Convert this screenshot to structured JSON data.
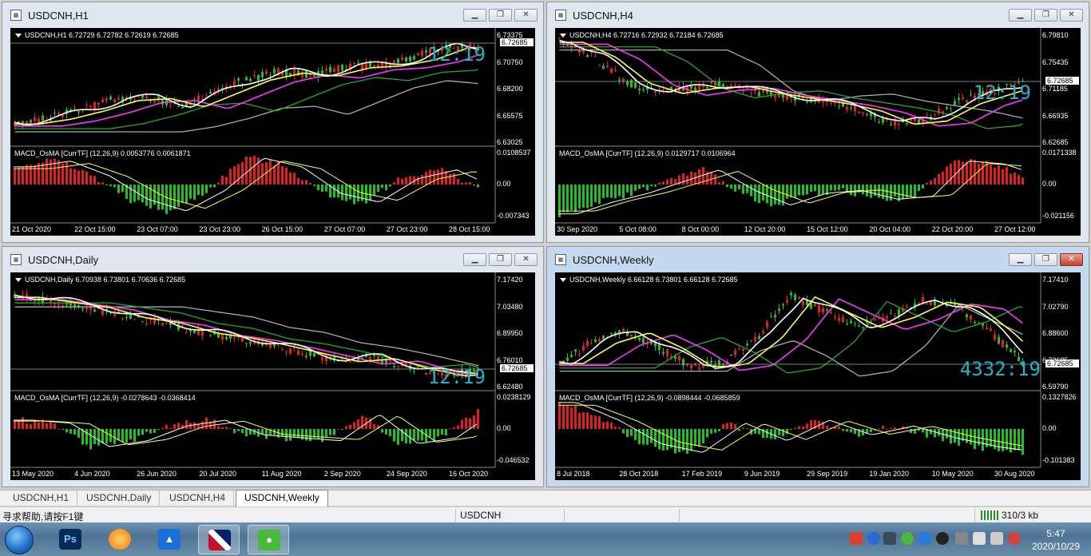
{
  "windows": [
    {
      "title": "USDCNH,H1",
      "header": "USDCNH,H1  6.72729 6.72782 6.72619 6.72685",
      "clock": "12:19",
      "y_main": [
        "6.73375",
        "6.70750",
        "6.68200",
        "6.65575",
        "6.63025"
      ],
      "price_tag": "6.72685",
      "macd_label": "MACD_OsMA [CurrTF] (12,26,9) 0.0053776 0.0061871",
      "y_macd": [
        "0.0108537",
        "0.00",
        "-0.007343"
      ],
      "x": [
        "21 Oct 2020",
        "22 Oct 15:00",
        "23 Oct 07:00",
        "23 Oct 23:00",
        "26 Oct 15:00",
        "27 Oct 07:00",
        "27 Oct 23:00",
        "28 Oct 15:00"
      ]
    },
    {
      "title": "USDCNH,H4",
      "header": "USDCNH,H4  6.72716 6.72932 6.72184 6.72685",
      "clock": "12:19",
      "y_main": [
        "6.79810",
        "6.75435",
        "6.71185",
        "6.66935",
        "6.62685"
      ],
      "price_tag": "6.72685",
      "macd_label": "MACD_OsMA [CurrTF] (12,26,9) 0.0129717 0.0106964",
      "y_macd": [
        "0.0171338",
        "0.00",
        "-0.021156"
      ],
      "x": [
        "30 Sep 2020",
        "5 Oct 08:00",
        "8 Oct 00:00",
        "12 Oct 20:00",
        "15 Oct 12:00",
        "20 Oct 04:00",
        "22 Oct 20:00",
        "27 Oct 12:00"
      ]
    },
    {
      "title": "USDCNH,Daily",
      "header": "USDCNH,Daily  6.70938 6.73801 6.70636 6.72685",
      "clock": "12:19",
      "y_main": [
        "7.17420",
        "7.03480",
        "6.89950",
        "6.76010",
        "6.62480"
      ],
      "price_tag": "6.72685",
      "macd_label": "MACD_OsMA [CurrTF] (12,26,9) -0.0278643 -0.0368414",
      "y_macd": [
        "0.0238129",
        "0.00",
        "-0.046532"
      ],
      "x": [
        "13 May 2020",
        "4 Jun 2020",
        "26 Jun 2020",
        "20 Jul 2020",
        "11 Aug 2020",
        "2 Sep 2020",
        "24 Sep 2020",
        "16 Oct 2020"
      ]
    },
    {
      "title": "USDCNH,Weekly",
      "header": "USDCNH,Weekly  6.66128 6.73801 6.66128 6.72685",
      "clock": "4332:19",
      "y_main": [
        "7.17410",
        "7.02790",
        "6.88600",
        "6.72685",
        "6.59790"
      ],
      "price_tag": "6.72685",
      "macd_label": "MACD_OsMA [CurrTF] (12,26,9) -0.0898444 -0.0685859",
      "y_macd": [
        "0.1327826",
        "0.00",
        "-0.101383"
      ],
      "x": [
        "8 Jul 2018",
        "28 Oct 2018",
        "17 Feb 2019",
        "9 Jun 2019",
        "29 Sep 2019",
        "19 Jan 2020",
        "10 May 2020",
        "30 Aug 2020"
      ]
    }
  ],
  "tabs": [
    "USDCNH,H1",
    "USDCNH,Daily",
    "USDCNH,H4",
    "USDCNH,Weekly"
  ],
  "active_tab": "USDCNH,Weekly",
  "status": {
    "help": "寻求帮助,请按F1键",
    "symbol": "USDCNH",
    "traffic": "310/3 kb"
  },
  "taskbar": {
    "time": "5:47",
    "date": "2020/10/29",
    "apps": [
      "photoshop-icon",
      "browser-icon",
      "cloud-drive-icon",
      "metatrader-icon",
      "wechat-icon"
    ]
  },
  "colors": {
    "up": "#22c022",
    "down": "#e02020",
    "ma_fast": "#ffffff",
    "ma_mid": "#ffff44",
    "ma_slow": "#ff33ff",
    "ma_long": "#22aa22",
    "ma_longest": "#aaaaaa",
    "clock": "#1fb3c9"
  }
}
